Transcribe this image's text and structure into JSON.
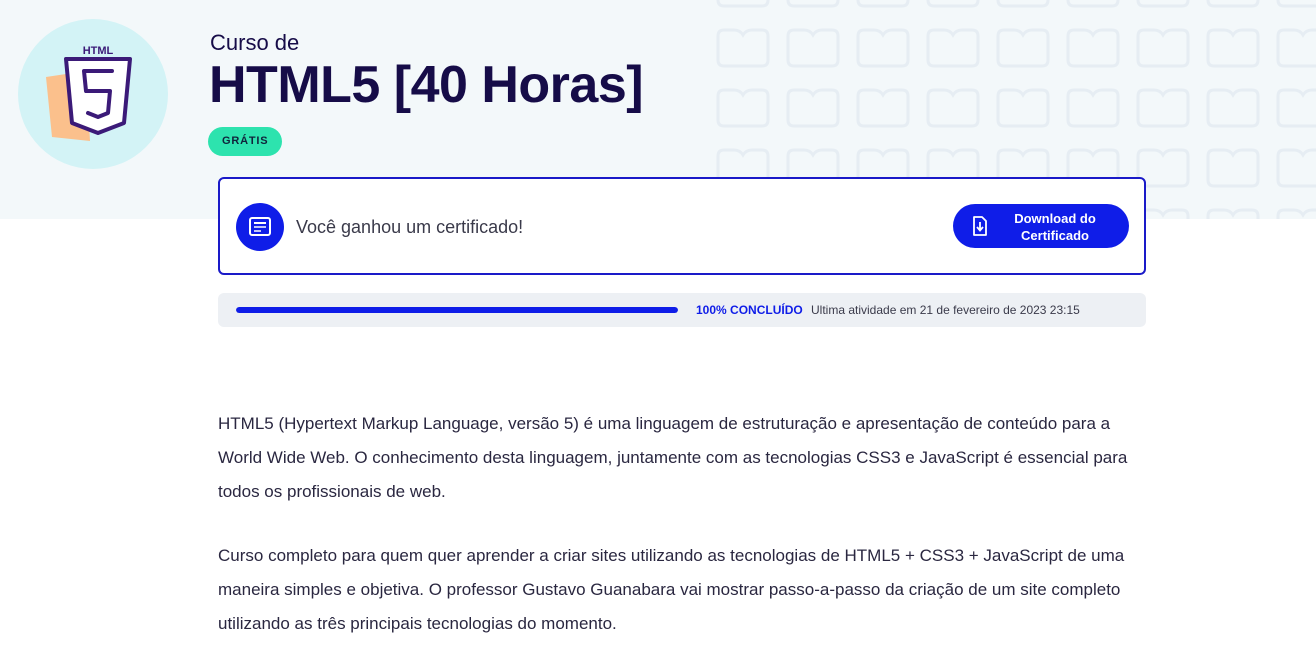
{
  "course": {
    "logo_text": "HTML",
    "logo_number": "5",
    "prefix": "Curso de",
    "title": "HTML5 [40 Horas]",
    "badge": "GRÁTIS"
  },
  "certificate": {
    "message": "Você ganhou um certificado!",
    "download_label": "Download do Certificado",
    "icon": "certificate-icon",
    "download_icon": "download-file-icon"
  },
  "progress": {
    "value_percent": 100,
    "label": "100% CONCLUÍDO",
    "last_activity": "Ultima atividade em 21 de fevereiro de 2023 23:15"
  },
  "description": [
    "HTML5 (Hypertext Markup Language, versão 5) é uma linguagem de estruturação e apresentação de conteúdo para a World Wide Web. O conhecimento desta linguagem, juntamente com as tecnologias CSS3 e JavaScript é essencial para todos os profissionais de web.",
    "Curso completo para quem quer aprender a criar sites utilizando as tecnologias de HTML5 + CSS3 + JavaScript de uma maneira simples e objetiva. O professor Gustavo Guanabara vai mostrar passo-a-passo da criação de um site completo utilizando as três principais tecnologias do momento."
  ],
  "colors": {
    "accent": "#0f1de8",
    "title": "#160c48",
    "badge": "#2de3ae",
    "hero_bg": "#f3f8fa"
  }
}
